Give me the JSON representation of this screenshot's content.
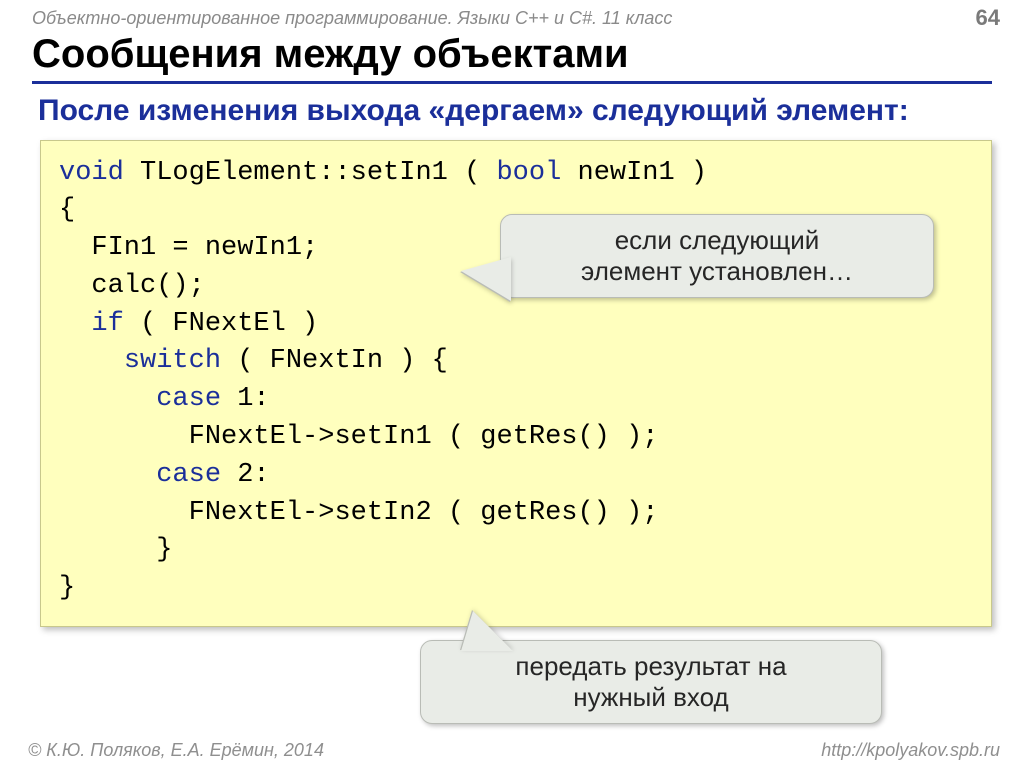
{
  "header": {
    "course": "Объектно-ориентированное программирование. Языки C++ и C#. 11 класс",
    "page_number": "64"
  },
  "title": "Сообщения между объектами",
  "subtitle": "После изменения выхода «дергаем» следующий элемент:",
  "code": {
    "l1_kw1": "void",
    "l1_txt": " TLogElement::setIn1 ( ",
    "l1_kw2": "bool",
    "l1_txt2": " newIn1 )",
    "l2": "{",
    "l3": "  FIn1 = newIn1;",
    "l4": "  calc();",
    "l5_pre": "  ",
    "l5_kw": "if",
    "l5_post": " ( FNextEl )",
    "l6_pre": "    ",
    "l6_kw": "switch",
    "l6_post": " ( FNextIn ) {",
    "l7_pre": "      ",
    "l7_kw": "case",
    "l7_post": " 1:",
    "l8": "        FNextEl->setIn1 ( getRes() );",
    "l9_pre": "      ",
    "l9_kw": "case",
    "l9_post": " 2:",
    "l10": "        FNextEl->setIn2 ( getRes() );",
    "l11": "      }",
    "l12": "}"
  },
  "callouts": {
    "c1_line1": "если следующий",
    "c1_line2": "элемент установлен…",
    "c2_line1": "передать результат на",
    "c2_line2": "нужный вход"
  },
  "footer": {
    "copyright": "© К.Ю. Поляков, Е.А. Ерёмин, 2014",
    "url": "http://kpolyakov.spb.ru"
  }
}
